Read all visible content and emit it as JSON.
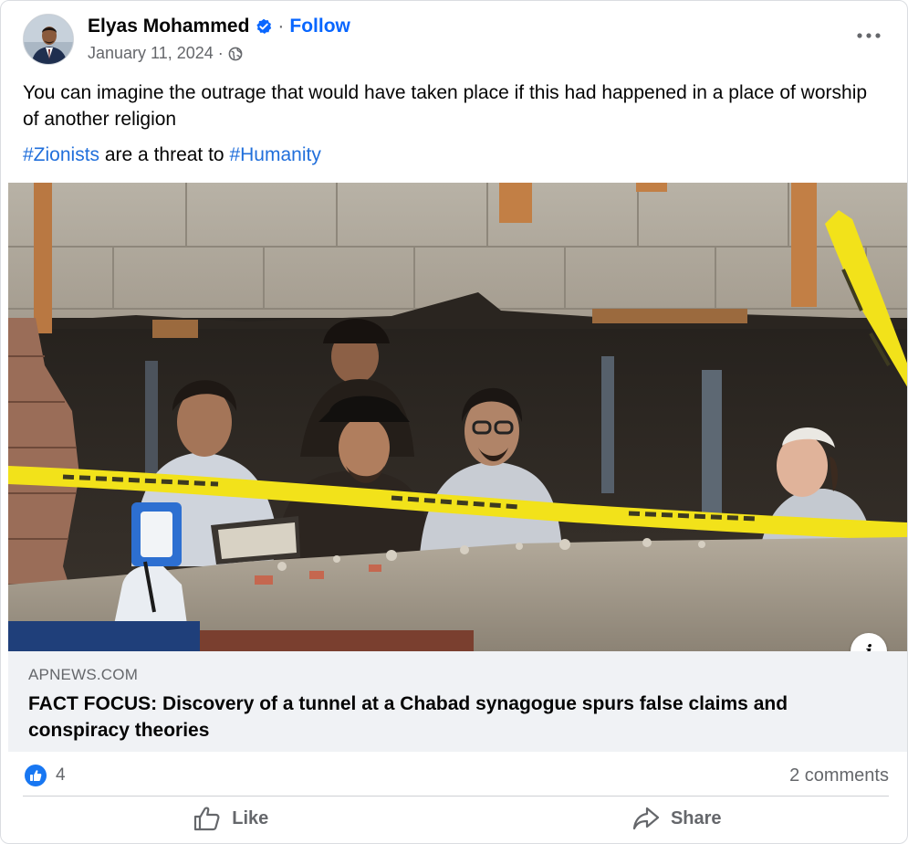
{
  "post": {
    "author": "Elyas Mohammed",
    "separator": "·",
    "follow_label": "Follow",
    "date": "January 11, 2024",
    "date_separator": "·",
    "privacy_icon": "globe-icon",
    "more_icon": "more-options-icon",
    "text": "You can imagine the outrage that would have taken place if this had happened in a place of worship of another religion",
    "hashtag_1": "#Zionists",
    "hashtag_middle": " are a threat to ",
    "hashtag_2": "#Humanity"
  },
  "link": {
    "info_label": "i",
    "domain": "APNEWS.COM",
    "title": "FACT FOCUS: Discovery of a tunnel at a Chabad synagogue spurs false claims and conspiracy theories"
  },
  "stats": {
    "reaction_count": "4",
    "comments": "2 comments"
  },
  "actions": {
    "like_label": "Like",
    "share_label": "Share"
  },
  "colors": {
    "accent": "#0866ff",
    "hashtag": "#216fdb",
    "secondary_text": "#65676b",
    "preview_bg": "#f0f2f5",
    "police_tape": "#f2e21a"
  }
}
